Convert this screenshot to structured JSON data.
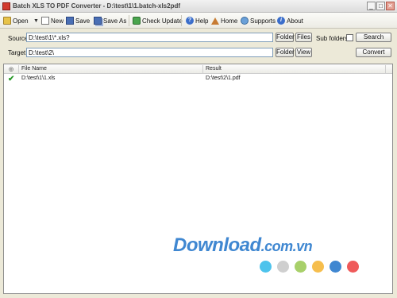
{
  "window": {
    "title": "Batch XLS TO PDF Converter - D:\\test\\1\\1.batch-xls2pdf",
    "minimize": "_",
    "maximize": "□",
    "close": "✕"
  },
  "toolbar": {
    "open": "Open",
    "new": "New",
    "save": "Save",
    "save_as": "Save As",
    "check_update": "Check Update",
    "help": "Help",
    "home": "Home",
    "supports": "Supports",
    "about": "About"
  },
  "source": {
    "label": "Source",
    "value": "D:\\test\\1\\*.xls?",
    "folder_button": "Folder",
    "files_button": "Files",
    "subfolders_label": "Sub folders",
    "subfolders_checked": false,
    "search_button": "Search"
  },
  "target": {
    "label": "Target",
    "value": "D:\\test\\2\\",
    "folder_button": "Folder",
    "view_button": "View",
    "convert_button": "Convert"
  },
  "list": {
    "columns": [
      "File Name",
      "Result"
    ],
    "rows": [
      {
        "status": "✔",
        "file_name": "D:\\test\\1\\1.xls",
        "result": "D:\\test\\2\\1.pdf"
      }
    ]
  },
  "watermark": {
    "text": "Download",
    "domain": ".com.vn",
    "dot_colors": [
      "#4dc3ec",
      "#cfcfcf",
      "#a8d06a",
      "#f6be4d",
      "#3f87d1",
      "#ef5a5a"
    ]
  }
}
